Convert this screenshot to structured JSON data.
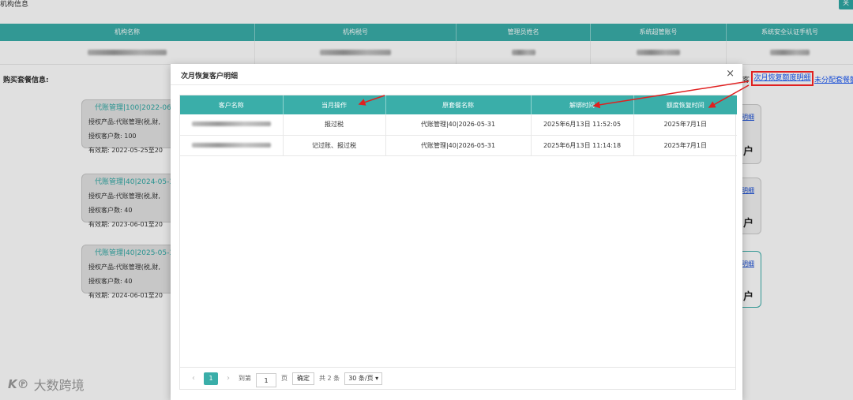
{
  "background": {
    "title": "机构信息",
    "close_button": "关",
    "table_headers": [
      "机构名称",
      "机构税号",
      "管理员姓名",
      "系统超管账号",
      "系统安全认证手机号"
    ],
    "section_label": "购买套餐信息:",
    "link_prefix": "客",
    "highlight_link": "次月恢复额度明细",
    "link2": "未分配套餐额",
    "cards": [
      {
        "title": "代账管理|100|2022-06-24",
        "product": "授权产品:代账管理(税,财,",
        "customers": "授权客户数: 100",
        "validity": "有效期: 2022-05-25至20"
      },
      {
        "title": "代账管理|40|2024-05-31",
        "product": "授权产品:代账管理(税,财,",
        "customers": "授权客户数: 40",
        "validity": "有效期: 2023-06-01至20"
      },
      {
        "title": "代账管理|40|2025-05-31",
        "product": "授权产品:代账管理(税,财,",
        "customers": "授权客户数: 40",
        "validity": "有效期: 2024-06-01至20"
      }
    ],
    "right_cards": [
      {
        "link": "明细",
        "heading": "户"
      },
      {
        "link": "明细",
        "heading": "户"
      },
      {
        "link": "明细",
        "heading": "户"
      }
    ]
  },
  "modal": {
    "title": "次月恢复客户明细",
    "close": "×",
    "columns": [
      "客户名称",
      "当月操作",
      "原套餐名称",
      "解绑时间",
      "额度恢复时间"
    ],
    "rows": [
      {
        "operation": "报过税",
        "package": "代账管理|40|2026-05-31",
        "unbind_time": "2025年6月13日 11:52:05",
        "restore_time": "2025年7月1日"
      },
      {
        "operation": "记过账、报过税",
        "package": "代账管理|40|2026-05-31",
        "unbind_time": "2025年6月13日 11:14:18",
        "restore_time": "2025年7月1日"
      }
    ],
    "pagination": {
      "prev": "‹",
      "current_page": "1",
      "next": "›",
      "goto_label": "到第",
      "goto_value": "1",
      "page_unit": "页",
      "confirm": "确定",
      "total": "共 2 条",
      "page_size": "30 条/页 ▾"
    }
  },
  "watermark": {
    "logo": "K℗",
    "text": "大数跨境"
  },
  "colors": {
    "accent": "#3aaea9",
    "link": "#1a4fd6",
    "highlight": "#e02020"
  }
}
